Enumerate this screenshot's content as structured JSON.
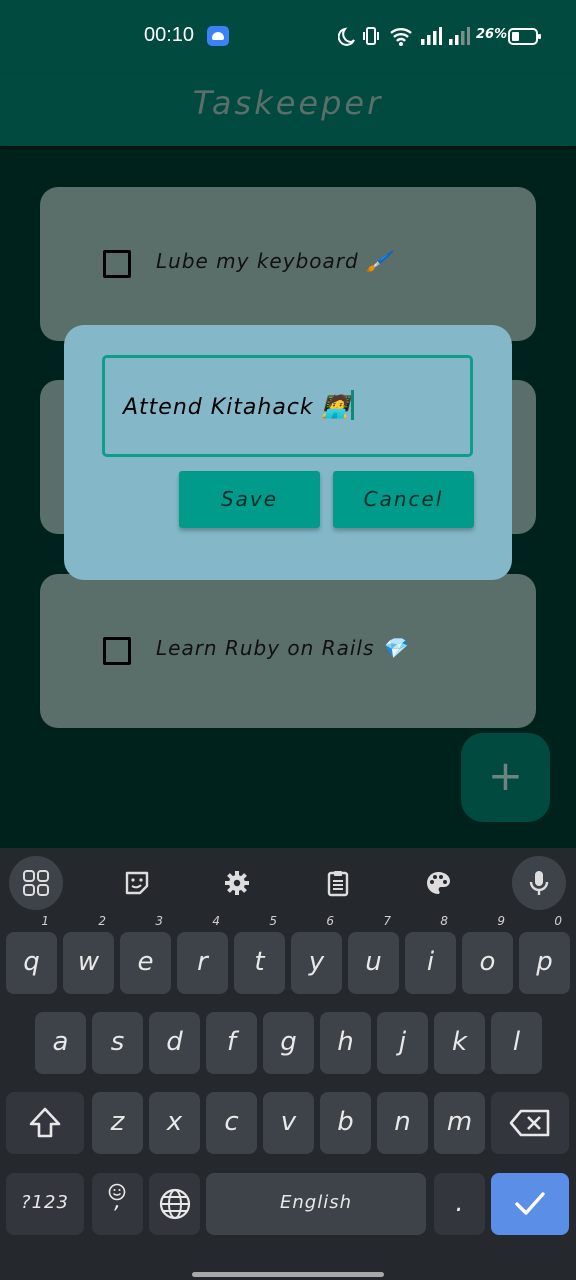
{
  "status_bar": {
    "time": "00:10",
    "battery": "26%",
    "icons": [
      "android-icon",
      "moon-icon",
      "vibrate-icon",
      "wifi-icon",
      "signal-icon",
      "signal-weak-icon",
      "battery-icon"
    ]
  },
  "app": {
    "title": "Taskeeper"
  },
  "tasks": [
    {
      "label": "Lube my keyboard 🖌️",
      "checked": false
    },
    {
      "label": "",
      "checked": false
    },
    {
      "label": "Learn Ruby on Rails 💎",
      "checked": false
    }
  ],
  "dialog": {
    "input_value": "Attend Kitahack 🧑‍💻",
    "save_label": "Save",
    "cancel_label": "Cancel"
  },
  "fab": {
    "symbol": "+"
  },
  "keyboard": {
    "toolbar": [
      "apps-icon",
      "sticker-icon",
      "settings-icon",
      "clipboard-icon",
      "palette-icon",
      "mic-icon"
    ],
    "row1": [
      {
        "key": "q",
        "hint": "1"
      },
      {
        "key": "w",
        "hint": "2"
      },
      {
        "key": "e",
        "hint": "3"
      },
      {
        "key": "r",
        "hint": "4"
      },
      {
        "key": "t",
        "hint": "5"
      },
      {
        "key": "y",
        "hint": "6"
      },
      {
        "key": "u",
        "hint": "7"
      },
      {
        "key": "i",
        "hint": "8"
      },
      {
        "key": "o",
        "hint": "9"
      },
      {
        "key": "p",
        "hint": "0"
      }
    ],
    "row2": [
      "a",
      "s",
      "d",
      "f",
      "g",
      "h",
      "j",
      "k",
      "l"
    ],
    "row3": [
      "z",
      "x",
      "c",
      "v",
      "b",
      "n",
      "m"
    ],
    "symbols_label": "?123",
    "comma_label": ",",
    "space_label": "English",
    "period_label": ".",
    "colors": {
      "enter": "#5b8ee6",
      "key": "#3e434a",
      "background": "#25292e"
    }
  }
}
